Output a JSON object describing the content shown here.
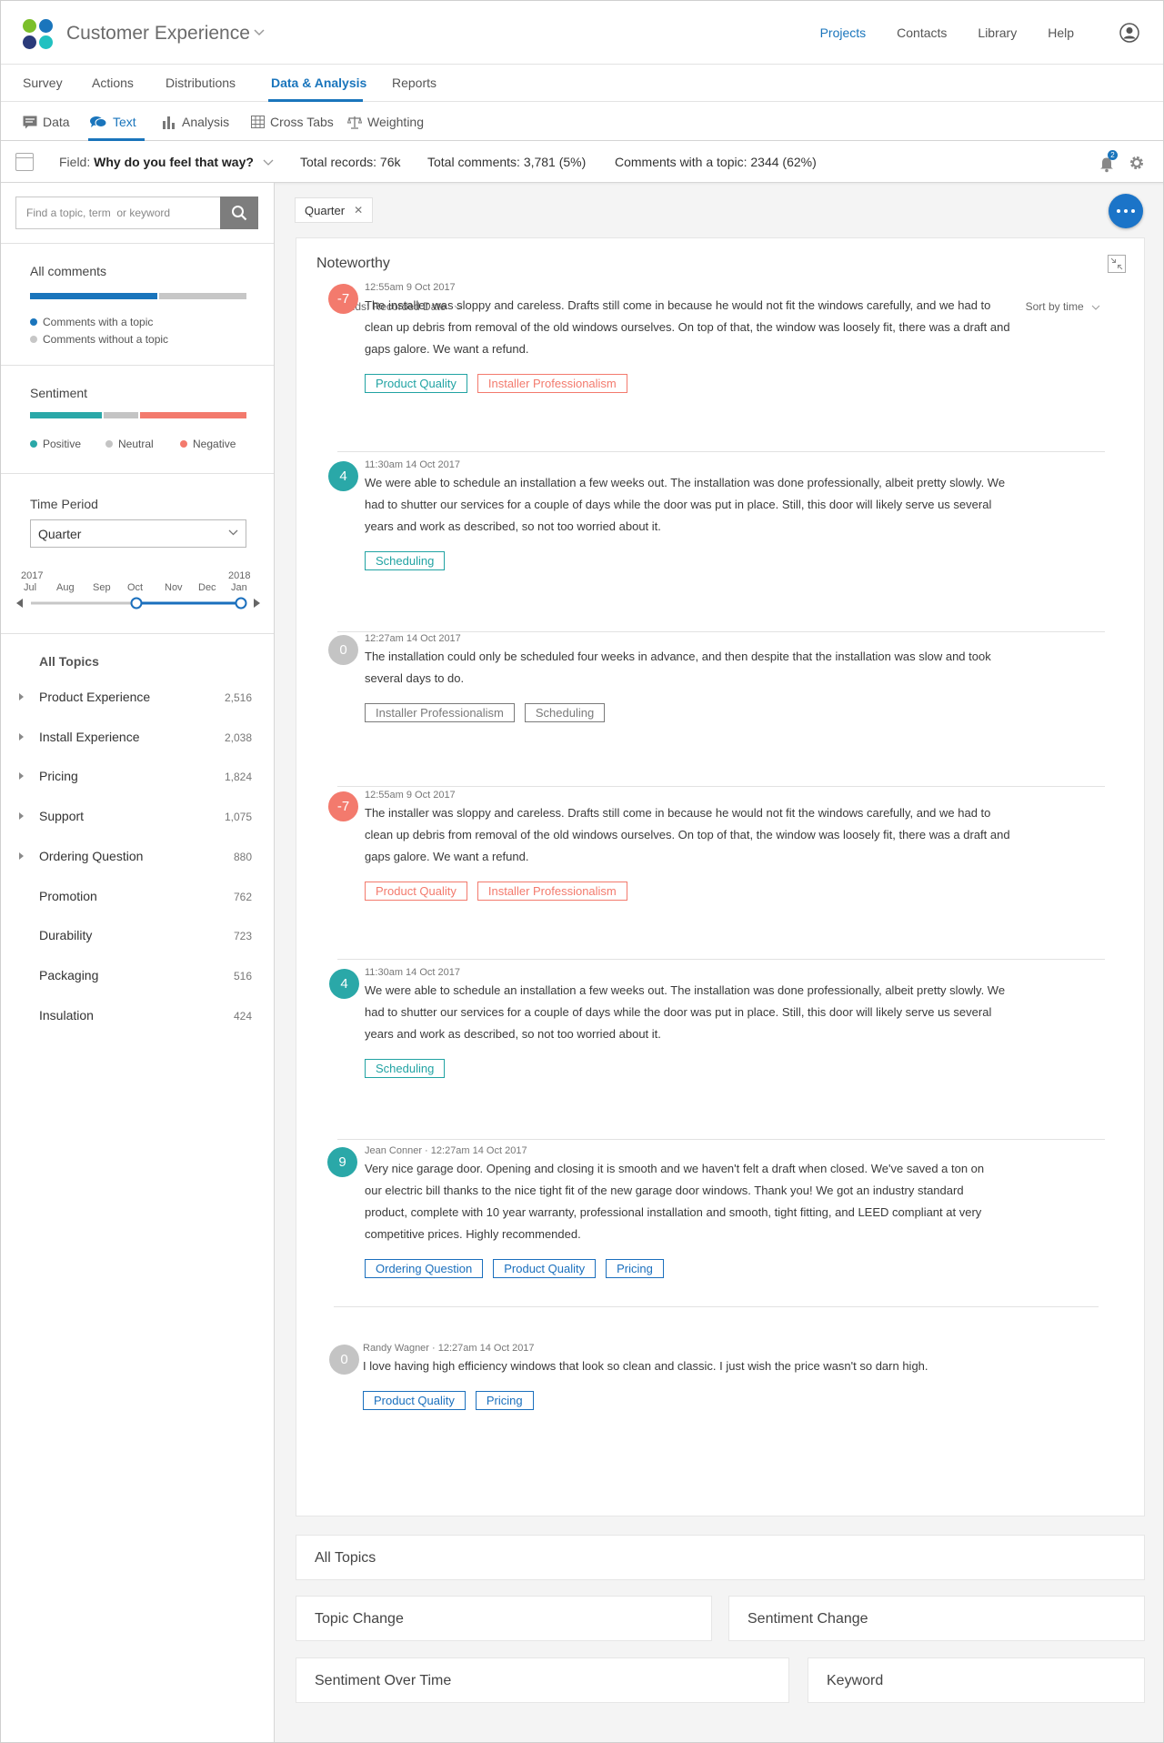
{
  "app": {
    "title": "Customer Experience",
    "logo_colors": [
      "#7bbf2b",
      "#1a75bc",
      "#2a3a7a",
      "#21c1c1"
    ]
  },
  "topnav": [
    "Projects",
    "Contacts",
    "Library",
    "Help"
  ],
  "tabs": [
    "Survey",
    "Actions",
    "Distributions",
    "Data & Analysis",
    "Reports"
  ],
  "subtabs": [
    "Data",
    "Text",
    "Analysis",
    "Cross Tabs",
    "Weighting"
  ],
  "fieldbar": {
    "field_label": "Field:",
    "field_value": "Why do you feel that way?",
    "total_records": "Total records: 76k",
    "total_comments": "Total comments: 3,781 (5%)",
    "with_topic": "Comments with a topic: 2344 (62%)",
    "notification_count": "2"
  },
  "sidebar": {
    "search_placeholder": "Find a topic, term  or keyword",
    "all_comments": {
      "title": "All comments",
      "with_topic_label": "Comments with a topic",
      "without_topic_label": "Comments without a topic",
      "with_topic_fraction": 0.59
    },
    "sentiment": {
      "title": "Sentiment",
      "positive": "Positive",
      "neutral": "Neutral",
      "negative": "Negative",
      "positive_fraction": 0.33,
      "neutral_fraction": 0.17,
      "negative_fraction": 0.5
    },
    "time_period": {
      "title": "Time Period",
      "selected": "Quarter",
      "year_start": "2017",
      "year_end": "2018",
      "months": [
        "Jul",
        "Aug",
        "Sep",
        "Oct",
        "Nov",
        "Dec",
        "Jan"
      ]
    },
    "topics_title": "All Topics",
    "topics": [
      {
        "name": "Product Experience",
        "count": "2,516",
        "expandable": true
      },
      {
        "name": "Install Experience",
        "count": "2,038",
        "expandable": true
      },
      {
        "name": "Pricing",
        "count": "1,824",
        "expandable": true
      },
      {
        "name": "Support",
        "count": "1,075",
        "expandable": true
      },
      {
        "name": "Ordering Question",
        "count": "880",
        "expandable": true
      },
      {
        "name": "Promotion",
        "count": "762",
        "expandable": false
      },
      {
        "name": "Durability",
        "count": "723",
        "expandable": false
      },
      {
        "name": "Packaging",
        "count": "516",
        "expandable": false
      },
      {
        "name": "Insulation",
        "count": "424",
        "expandable": false
      }
    ]
  },
  "filter_chip": {
    "label": "Quarter",
    "close": "✕"
  },
  "noteworthy": {
    "title": "Noteworthy",
    "fields_dropdown": "Fields: Recorded Date",
    "sort_dropdown": "Sort by time",
    "comments": [
      {
        "score": "-7",
        "color": "#f37a6d",
        "author": "",
        "time": "12:55am 9 Oct 2017",
        "text": [
          "The installer was sloppy and careless. Drafts still come in because he would not fit the windows carefully, and we had to",
          "clean up debris from removal of the old windows ourselves. On top of that, the window was loosely fit, there was a draft and",
          "gaps galore. We want a refund."
        ],
        "tags": [
          {
            "label": "Product Quality",
            "color": "#21a3a3"
          },
          {
            "label": "Installer Professionalism",
            "color": "#f37a6d"
          }
        ]
      },
      {
        "score": "4",
        "color": "#2aa8a8",
        "author": "",
        "time": "11:30am 14 Oct 2017",
        "text": [
          "We were able to schedule an installation a few weeks out. The installation was done professionally, albeit pretty slowly. We",
          "had to shutter our services for a couple of days while the door was put in place. Still, this door will likely serve us several",
          "years and work as described, so not too worried about it."
        ],
        "tags": [
          {
            "label": "Scheduling",
            "color": "#21a3a3"
          }
        ]
      },
      {
        "score": "0",
        "color": "#c4c4c4",
        "author": "",
        "time": "12:27am 14 Oct 2017",
        "text": [
          "The installation could only be scheduled four weeks in advance, and then despite that the installation was slow and took",
          "several days to do."
        ],
        "tags": [
          {
            "label": "Installer Professionalism",
            "color": "#7a7a7a"
          },
          {
            "label": "Scheduling",
            "color": "#7a7a7a"
          }
        ]
      },
      {
        "score": "-7",
        "color": "#f37a6d",
        "author": "",
        "time": "12:55am 9 Oct 2017",
        "text": [
          "The installer was sloppy and careless. Drafts still come in because he would not fit the windows carefully, and we had to",
          "clean up debris from removal of the old windows ourselves. On top of that, the window was loosely fit, there was a draft and",
          "gaps galore. We want a refund."
        ],
        "tags": [
          {
            "label": "Product Quality",
            "color": "#f37a6d"
          },
          {
            "label": "Installer Professionalism",
            "color": "#f37a6d"
          }
        ]
      },
      {
        "score": "4",
        "color": "#2aa8a8",
        "author": "",
        "time": "11:30am 14 Oct 2017",
        "text": [
          "We were able to schedule an installation a few weeks out. The installation was done professionally, albeit pretty slowly. We",
          "had to shutter our services for a couple of days while the door was put in place. Still, this door will likely serve us several",
          "years and work as described, so not too worried about it."
        ],
        "tags": [
          {
            "label": "Scheduling",
            "color": "#21a3a3"
          }
        ]
      },
      {
        "score": "9",
        "color": "#2aa8a8",
        "author": "Jean Conner",
        "time": "12:27am 14 Oct 2017",
        "text": [
          "Very nice garage door. Opening and closing it is smooth and we haven't felt a draft when closed. We've saved a ton on",
          "our electric bill thanks to the nice tight fit of the new garage door windows. Thank you! We got an industry standard",
          "product, complete with 10 year warranty, professional installation and smooth, tight fitting, and LEED compliant at very",
          "competitive prices. Highly recommended."
        ],
        "tags": [
          {
            "label": "Ordering Question",
            "color": "#1a6fbd"
          },
          {
            "label": "Product Quality",
            "color": "#1a6fbd"
          },
          {
            "label": "Pricing",
            "color": "#1a6fbd"
          }
        ]
      },
      {
        "score": "0",
        "color": "#c4c4c4",
        "author": "Randy Wagner",
        "time": "12:27am 14 Oct 2017",
        "text": [
          "I love having high efficiency windows that look so clean and classic. I just wish the price wasn't so darn high."
        ],
        "tags": [
          {
            "label": "Product Quality",
            "color": "#1a6fbd"
          },
          {
            "label": "Pricing",
            "color": "#1a6fbd"
          }
        ]
      }
    ]
  },
  "panels": {
    "all_topics": "All Topics",
    "topic_change": "Topic Change",
    "sentiment_change": "Sentiment Change",
    "sentiment_over_time": "Sentiment Over Time",
    "keyword": "Keyword"
  },
  "colors": {
    "accent": "#1a75bc",
    "topic_bar": "#1a75bc",
    "no_topic_bar": "#c7c7c7",
    "positive": "#2aa8a8",
    "neutral": "#c4c4c4",
    "negative": "#f37a6d"
  }
}
